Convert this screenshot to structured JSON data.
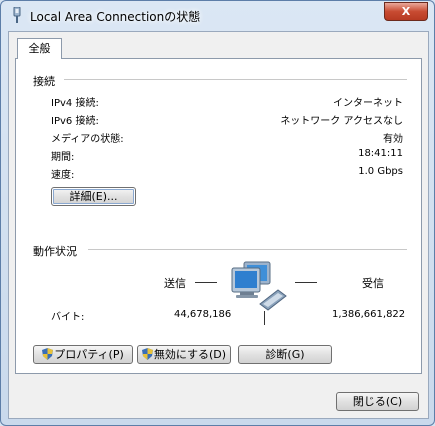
{
  "window": {
    "title": "Local Area Connectionの状態",
    "close_label": "X"
  },
  "tab": {
    "label": "全般"
  },
  "connection": {
    "group_label": "接続",
    "rows": [
      {
        "label": "IPv4 接続:",
        "value": "インターネット"
      },
      {
        "label": "IPv6 接続:",
        "value": "ネットワーク アクセスなし"
      },
      {
        "label": "メディアの状態:",
        "value": "有効"
      },
      {
        "label": "期間:",
        "value": "18:41:11"
      },
      {
        "label": "速度:",
        "value": "1.0 Gbps"
      }
    ],
    "details_button": "詳細(E)..."
  },
  "activity": {
    "group_label": "動作状況",
    "sent_label": "送信",
    "received_label": "受信",
    "bytes_label": "バイト:",
    "bytes_sent": "44,678,186",
    "bytes_received": "1,386,661,822"
  },
  "buttons": {
    "properties": "プロパティ(P)",
    "disable": "無効にする(D)",
    "diagnose": "診断(G)"
  },
  "footer": {
    "close": "閉じる(C)"
  }
}
